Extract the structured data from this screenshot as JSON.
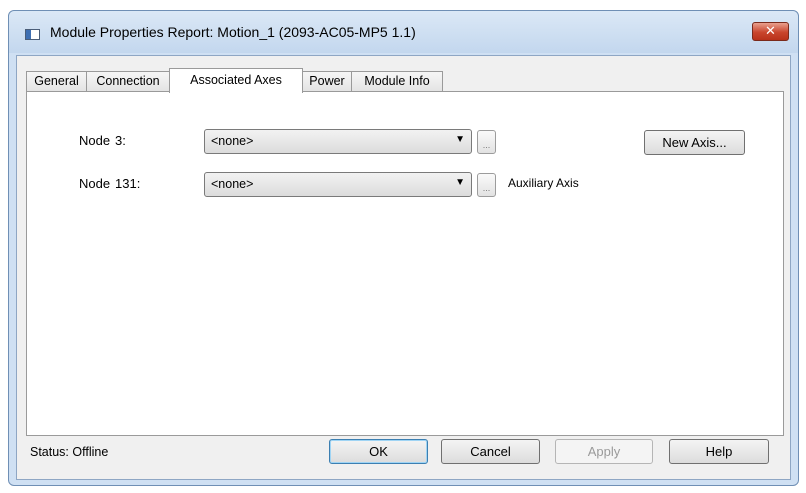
{
  "window": {
    "title": "Module Properties Report: Motion_1 (2093-AC05-MP5 1.1)",
    "close_label": "✕"
  },
  "tabs": [
    {
      "label": "General",
      "active": false
    },
    {
      "label": "Connection",
      "active": false
    },
    {
      "label": "Associated Axes",
      "active": true
    },
    {
      "label": "Power",
      "active": false
    },
    {
      "label": "Module Info",
      "active": false
    }
  ],
  "nodes": [
    {
      "label": "Node",
      "number": "3:",
      "value": "<none>",
      "ellipsis": "...",
      "note": ""
    },
    {
      "label": "Node",
      "number": "131:",
      "value": "<none>",
      "ellipsis": "...",
      "note": "Auxiliary Axis"
    }
  ],
  "new_axis_label": "New Axis...",
  "status": {
    "label": "Status:",
    "value": "Offline"
  },
  "buttons": {
    "ok": "OK",
    "cancel": "Cancel",
    "apply": "Apply",
    "help": "Help"
  },
  "icons": {
    "app": "module-window-icon",
    "close": "close-icon",
    "dropdown": "chevron-down-icon"
  },
  "colors": {
    "close": "#c9452d",
    "frame": "#cfe0f3",
    "client": "#f0f0f0"
  }
}
